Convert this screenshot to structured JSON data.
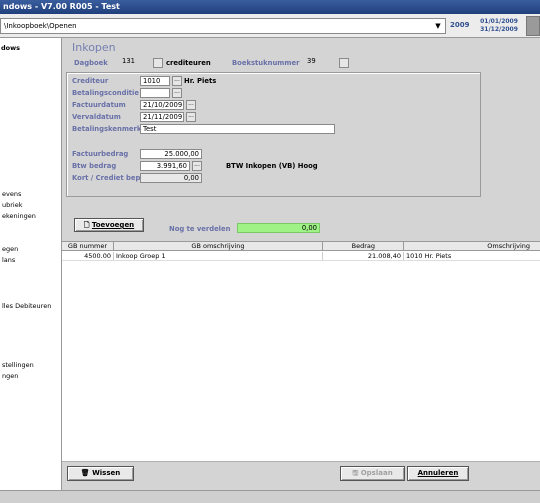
{
  "window": {
    "title": "ndows - V7.00 R005 - Test"
  },
  "pathbar": {
    "path": "\\Inkoopboek\\Openen",
    "year": "2009",
    "period_start": "01/01/2009",
    "period_end": "31/12/2009"
  },
  "sidebar": {
    "items": [
      {
        "label": "dows",
        "bold": true
      },
      {
        "label": "evens",
        "bold": false
      },
      {
        "label": "ubriek",
        "bold": false
      },
      {
        "label": "ekeningen",
        "bold": false
      },
      {
        "label": "egen",
        "bold": false
      },
      {
        "label": "lans",
        "bold": false
      },
      {
        "label": "lles Debiteuren",
        "bold": false
      },
      {
        "label": "stellingen",
        "bold": false
      },
      {
        "label": "ngen",
        "bold": false
      }
    ]
  },
  "page": {
    "title": "Inkopen"
  },
  "header_fields": {
    "dagboek_label": "Dagboek",
    "dagboek_value": "131",
    "dagboek_name": "crediteuren",
    "boekstuk_label": "Boekstuknummer",
    "boekstuk_value": "39"
  },
  "form": {
    "crediteur": {
      "label": "Crediteur",
      "value": "1010",
      "name": "Hr. Piets"
    },
    "betalingsconditie": {
      "label": "Betalingsconditie",
      "value": ""
    },
    "factuurdatum": {
      "label": "Factuurdatum",
      "value": "21/10/2009"
    },
    "vervaldatum": {
      "label": "Vervaldatum",
      "value": "21/11/2009"
    },
    "betalingskenmerk": {
      "label": "Betalingskenmerk",
      "value": "Test"
    },
    "factuurbedrag": {
      "label": "Factuurbedrag",
      "value": "25.000,00"
    },
    "btw_bedrag": {
      "label": "Btw bedrag",
      "value": "3.991,60",
      "code": "BTW Inkopen (VB) Hoog"
    },
    "kort": {
      "label": "Kort / Crediet bep.",
      "value": "0,00"
    }
  },
  "actions": {
    "toevoegen_label": "Toevoegen",
    "nog_te_verdelen_label": "Nog te verdelen",
    "nog_te_verdelen_value": "0,00",
    "wissen_label": "Wissen",
    "opslaan_label": "Opslaan",
    "annuleren_label": "Annuleren"
  },
  "grid": {
    "columns": [
      "GB nummer",
      "GB omschrijving",
      "Bedrag",
      "Omschrijving"
    ],
    "rows": [
      {
        "gb_nummer": "4500.00",
        "gb_omschrijving": "Inkoop Groep 1",
        "bedrag": "21.008,40",
        "omschrijving": "1010 Hr. Piets"
      }
    ]
  },
  "colors": {
    "label": "#6870a8",
    "title": "#7680b2",
    "progress": "#9ef286",
    "titlebar": "#2a4b8c"
  }
}
